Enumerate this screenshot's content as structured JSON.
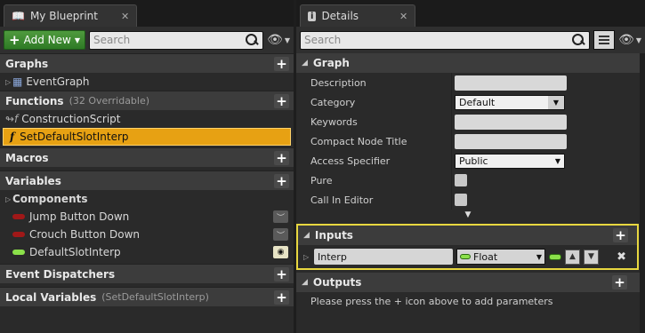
{
  "left_panel": {
    "tab_title": "My Blueprint",
    "add_new_label": "Add New",
    "search_placeholder": "Search",
    "sections": {
      "graphs": {
        "title": "Graphs",
        "items": [
          "EventGraph"
        ]
      },
      "functions": {
        "title": "Functions",
        "sub": "(32 Overridable)",
        "items": [
          "ConstructionScript",
          "SetDefaultSlotInterp"
        ]
      },
      "macros": {
        "title": "Macros"
      },
      "variables": {
        "title": "Variables",
        "group": "Components",
        "items": [
          "Jump Button Down",
          "Crouch Button Down",
          "DefaultSlotInterp"
        ]
      },
      "event_dispatchers": {
        "title": "Event Dispatchers"
      },
      "local_variables": {
        "title": "Local Variables",
        "sub": "(SetDefaultSlotInterp)"
      }
    }
  },
  "right_panel": {
    "tab_title": "Details",
    "search_placeholder": "Search",
    "graph": {
      "title": "Graph",
      "props": {
        "description": "Description",
        "category": "Category",
        "category_value": "Default",
        "keywords": "Keywords",
        "compact_node_title": "Compact Node Title",
        "access_specifier": "Access Specifier",
        "access_value": "Public",
        "pure": "Pure",
        "call_in_editor": "Call In Editor"
      }
    },
    "inputs": {
      "title": "Inputs",
      "param_name": "Interp",
      "param_type": "Float"
    },
    "outputs": {
      "title": "Outputs",
      "hint": "Please press the + icon above to add parameters"
    }
  },
  "colors": {
    "selection": "#e7a113",
    "highlight_border": "#e8d740",
    "float_pin": "#8be04a",
    "bool_pin": "#a01818"
  }
}
